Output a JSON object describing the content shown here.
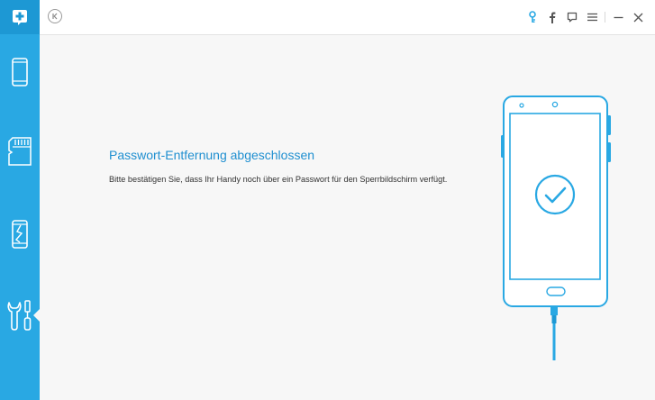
{
  "app": {
    "logo_icon": "plus-badge-icon",
    "accent_color": "#29a8e3",
    "sidebar_color": "#29a8e3"
  },
  "sidebar": {
    "items": [
      {
        "id": "phone",
        "icon": "phone-icon",
        "active": false
      },
      {
        "id": "sdcard",
        "icon": "sd-card-icon",
        "active": false
      },
      {
        "id": "broken-screen",
        "icon": "broken-phone-icon",
        "active": false
      },
      {
        "id": "repair",
        "icon": "wrench-screwdriver-icon",
        "active": true
      }
    ]
  },
  "topbar": {
    "back_icon": "back-circle-icon",
    "icons": [
      "key-icon",
      "facebook-icon",
      "feedback-icon",
      "menu-icon",
      "minimize-icon",
      "close-icon"
    ]
  },
  "main": {
    "title": "Passwort-Entfernung abgeschlossen",
    "description": "Bitte bestätigen Sie, dass Ihr Handy noch über ein Passwort für den Sperrbildschirm verfügt.",
    "illustration_icon": "phone-check-icon"
  }
}
